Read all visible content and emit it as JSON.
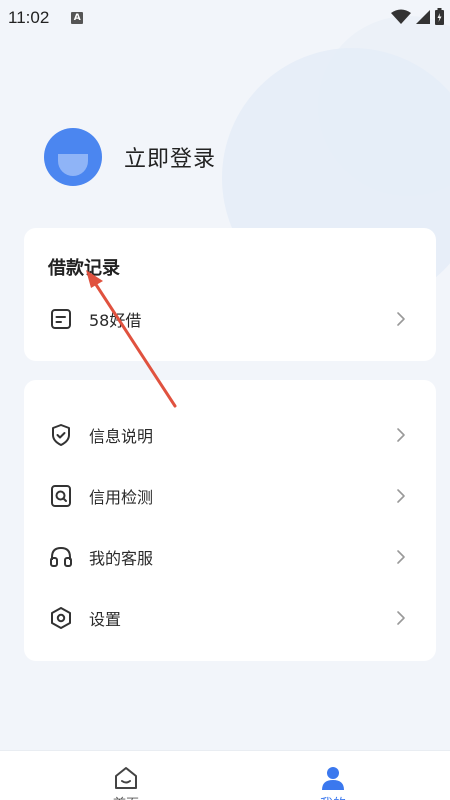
{
  "status_bar": {
    "time": "11:02",
    "notification_badge": "A"
  },
  "profile": {
    "login_label": "立即登录"
  },
  "loan_records": {
    "title": "借款记录",
    "items": [
      {
        "label": "58好借",
        "icon": "document-icon"
      }
    ]
  },
  "menu": {
    "items": [
      {
        "label": "信息说明",
        "icon": "shield-check-icon"
      },
      {
        "label": "信用检测",
        "icon": "search-document-icon"
      },
      {
        "label": "我的客服",
        "icon": "headphones-icon"
      },
      {
        "label": "设置",
        "icon": "settings-hexagon-icon"
      }
    ]
  },
  "tabbar": {
    "tabs": [
      {
        "label": "首页",
        "icon": "home-icon",
        "active": false
      },
      {
        "label": "我的",
        "icon": "user-icon",
        "active": true
      }
    ]
  },
  "colors": {
    "accent": "#3b78ee",
    "avatar": "#4b86f0",
    "annotation_arrow": "#e0523f",
    "background": "#f2f5fa"
  }
}
